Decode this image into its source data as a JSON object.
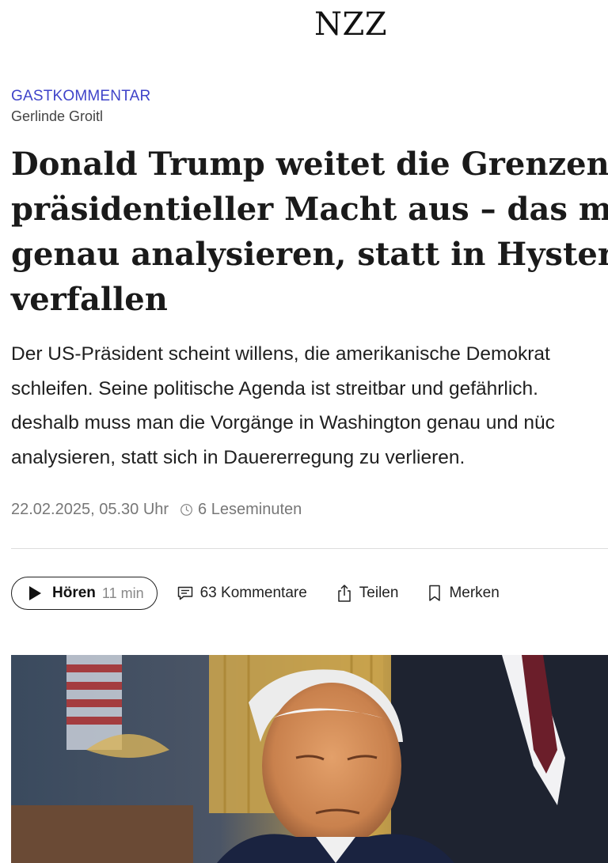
{
  "brand": {
    "name": "NZZ"
  },
  "article": {
    "kicker": "GASTKOMMENTAR",
    "author": "Gerlinde Groitl",
    "headline_lines": [
      "Donald Trump weitet die Grenzen",
      "präsidentieller Macht aus – das muss m",
      "genau analysieren, statt in Hysterie zu",
      "verfallen"
    ],
    "lead_lines": [
      "Der US-Präsident scheint willens, die amerikanische Demokrat",
      "schleifen. Seine politische Agenda ist streitbar und gefährlich.",
      "deshalb muss man die Vorgänge in Washington genau und nüc",
      "analysieren, statt sich in Dauererregung zu verlieren."
    ],
    "date": "22.02.2025, 05.30 Uhr",
    "reading_time": "6 Leseminuten"
  },
  "actions": {
    "listen_label": "Hören",
    "listen_duration": "11 min",
    "comments_label": "63 Kommentare",
    "share_label": "Teilen",
    "save_label": "Merken"
  },
  "icons": {
    "play": "play-icon",
    "comments": "comment-icon",
    "share": "share-icon",
    "save": "bookmark-icon",
    "clock": "clock-icon"
  },
  "colors": {
    "kicker": "#3f43c9",
    "text": "#111111",
    "meta": "#777777",
    "divider": "#dddddd"
  }
}
